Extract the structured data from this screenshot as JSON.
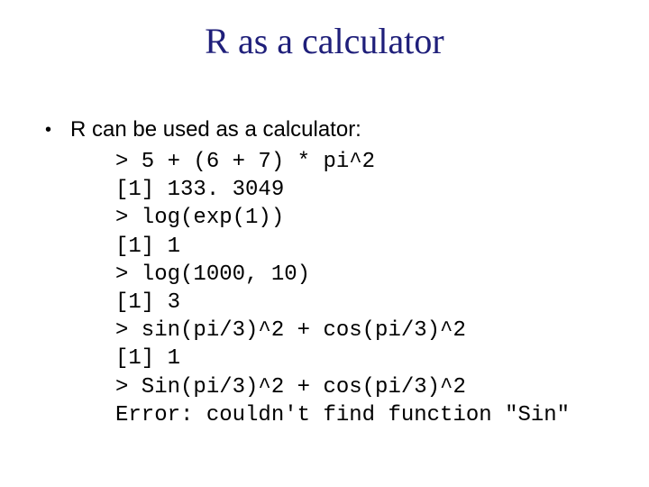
{
  "title": "R as a calculator",
  "bullet": {
    "dot": "•",
    "text": "R can be used as a calculator:"
  },
  "code": {
    "l0": "> 5 + (6 + 7) * pi^2",
    "l1": "[1] 133. 3049",
    "l2": "> log(exp(1))",
    "l3": "[1] 1",
    "l4": "> log(1000, 10)",
    "l5": "[1] 3",
    "l6": "> sin(pi/3)^2 + cos(pi/3)^2",
    "l7": "[1] 1",
    "l8": "> Sin(pi/3)^2 + cos(pi/3)^2",
    "l9": "Error: couldn't find function \"Sin\""
  }
}
